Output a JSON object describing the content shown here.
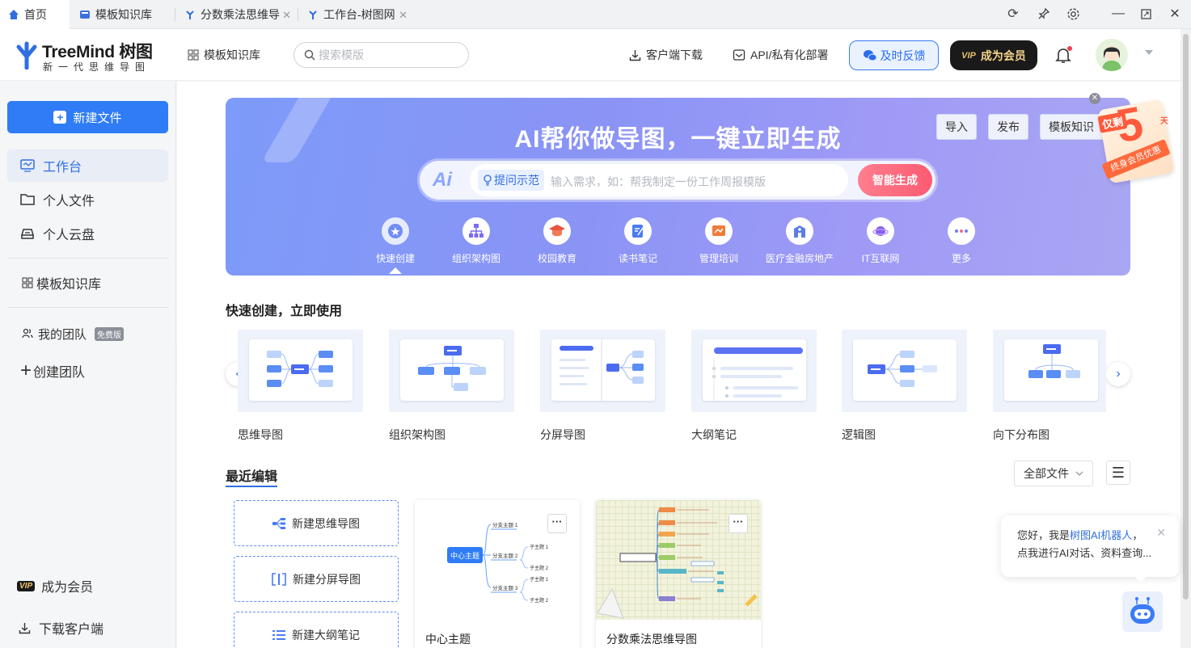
{
  "tabs": [
    {
      "label": "首页",
      "active": true
    },
    {
      "label": "模板知识库",
      "active": false
    },
    {
      "label": "分数乘法思维导",
      "active": false
    },
    {
      "label": "工作台-树图网",
      "active": false
    }
  ],
  "header": {
    "brand": "TreeMind 树图",
    "slogan": "新一代思维导图",
    "template_link": "模板知识库",
    "search_placeholder": "搜索模版",
    "download": "客户端下载",
    "api": "API/私有化部署",
    "feedback": "及时反馈",
    "vip_tag": "VIP",
    "vip_label": "成为会员"
  },
  "sidebar": {
    "new_file": "新建文件",
    "items": [
      {
        "label": "工作台",
        "icon": "monitor-icon"
      },
      {
        "label": "个人文件",
        "icon": "folder-icon"
      },
      {
        "label": "个人云盘",
        "icon": "cloud-drive-icon"
      }
    ],
    "template_lib": "模板知识库",
    "my_team": "我的团队",
    "free_badge": "免费版",
    "create_team": "创建团队",
    "vip_tag": "VIP",
    "become_member": "成为会员",
    "download_client": "下载客户端"
  },
  "banner": {
    "title": "AI帮你做导图，一键立即生成",
    "import": "导入",
    "publish": "发布",
    "template": "模板知识",
    "ai_logo": "Ai",
    "tip": "提问示范",
    "placeholder": "输入需求，如：帮我制定一份工作周报模版",
    "generate": "智能生成",
    "categories": [
      {
        "label": "快速创建",
        "color": "#6f8df5"
      },
      {
        "label": "组织架构图",
        "color": "#7b6cf0"
      },
      {
        "label": "校园教育",
        "color": "#e9553e"
      },
      {
        "label": "读书笔记",
        "color": "#4b7cf3"
      },
      {
        "label": "管理培训",
        "color": "#f07a3b"
      },
      {
        "label": "医疗金融房地产",
        "color": "#5c7de8"
      },
      {
        "label": "IT互联网",
        "color": "#8a5cf0"
      },
      {
        "label": "更多",
        "color": "#6f7cf5"
      }
    ],
    "promo_only": "仅剩",
    "promo_number": "5",
    "promo_unit": "天",
    "promo_ribbon": "终身会员优惠"
  },
  "quick_create": {
    "title": "快速创建，立即使用",
    "items": [
      "思维导图",
      "组织架构图",
      "分屏导图",
      "大纲笔记",
      "逻辑图",
      "向下分布图"
    ]
  },
  "recent": {
    "title": "最近编辑",
    "filter": "全部文件",
    "new_buttons": [
      "新建思维导图",
      "新建分屏导图",
      "新建大纲笔记"
    ],
    "docs": [
      {
        "name": "中心主题",
        "center": "中心主题",
        "branches": [
          "分支主题 1",
          "分支主题 2",
          "分支主题 3"
        ],
        "subs": [
          "子主题 1",
          "子主题 2"
        ]
      },
      {
        "name": "分数乘法思维导图"
      }
    ]
  },
  "robot": {
    "line1_prefix": "您好，我是",
    "line1_highlight": "树图AI机器人",
    "line1_suffix": "，",
    "line2": "点我进行AI对话、资料查询..."
  }
}
